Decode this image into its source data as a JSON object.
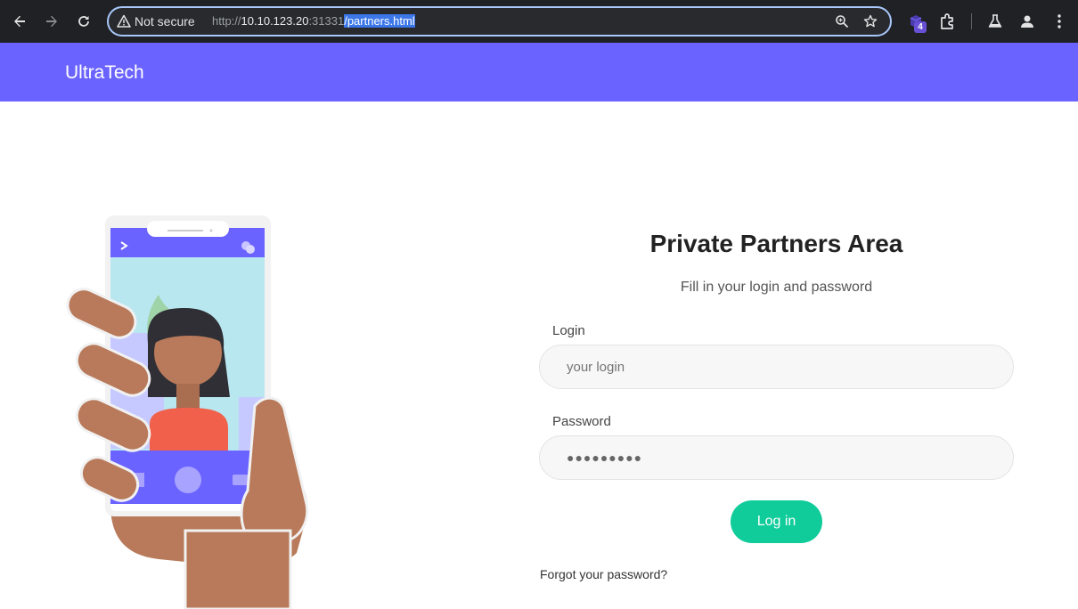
{
  "browser": {
    "security_label": "Not secure",
    "url_scheme": "http://",
    "url_host": "10.10.123.20",
    "url_port": ":31331",
    "url_path": "/partners.html",
    "extension_badge": "4",
    "icons": [
      "back-arrow-icon",
      "forward-arrow-icon",
      "reload-icon",
      "warning-icon",
      "zoom-icon",
      "star-icon",
      "extension-icon",
      "puzzle-icon",
      "labs-flask-icon",
      "profile-icon",
      "menu-dots-icon"
    ]
  },
  "site": {
    "brand": "UltraTech",
    "header_color": "#6a63ff"
  },
  "form": {
    "title": "Private Partners Area",
    "subtitle": "Fill in your login and password",
    "login_label": "Login",
    "login_placeholder": "your login",
    "password_label": "Password",
    "password_value": "●●●●●●●●●",
    "submit_label": "Log in",
    "submit_color": "#10cc9a",
    "forgot_link": "Forgot your password?"
  }
}
